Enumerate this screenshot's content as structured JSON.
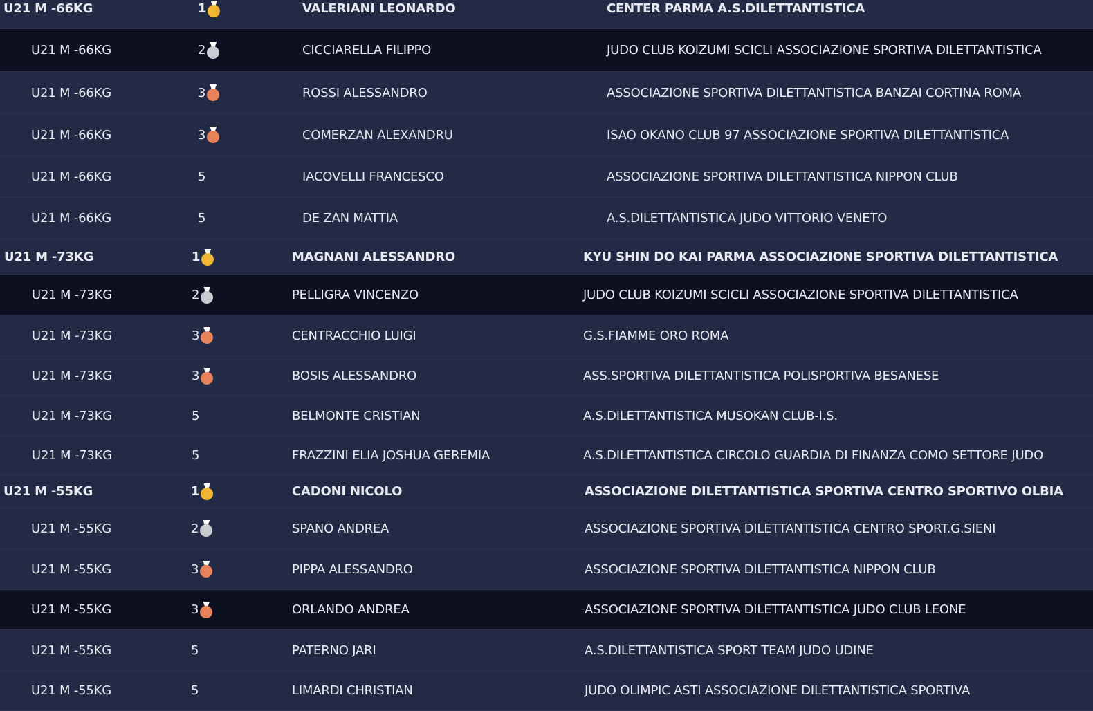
{
  "medal_colors": {
    "gold": "#f2b635",
    "silver": "#c9cbd1",
    "bronze": "#e8825a"
  },
  "groups": [
    {
      "category": "U21 M -66KG",
      "rows": [
        {
          "category": "U21 M -66KG",
          "place": "1",
          "medal": "gold",
          "name": "VALERIANI LEONARDO",
          "club": "CENTER PARMA A.S.DILETTANTISTICA",
          "head": true,
          "dark": false
        },
        {
          "category": "U21 M -66KG",
          "place": "2",
          "medal": "silver",
          "name": "CICCIARELLA FILIPPO",
          "club": "JUDO CLUB KOIZUMI SCICLI ASSOCIAZIONE SPORTIVA DILETTANTISTICA",
          "head": false,
          "dark": true
        },
        {
          "category": "U21 M -66KG",
          "place": "3",
          "medal": "bronze",
          "name": "ROSSI ALESSANDRO",
          "club": "ASSOCIAZIONE SPORTIVA DILETTANTISTICA BANZAI CORTINA ROMA",
          "head": false,
          "dark": false
        },
        {
          "category": "U21 M -66KG",
          "place": "3",
          "medal": "bronze",
          "name": "COMERZAN ALEXANDRU",
          "club": "ISAO OKANO CLUB 97 ASSOCIAZIONE SPORTIVA DILETTANTISTICA",
          "head": false,
          "dark": false
        },
        {
          "category": "U21 M -66KG",
          "place": "5",
          "medal": "",
          "name": "IACOVELLI FRANCESCO",
          "club": "ASSOCIAZIONE SPORTIVA DILETTANTISTICA NIPPON CLUB",
          "head": false,
          "dark": false
        },
        {
          "category": "U21 M -66KG",
          "place": "5",
          "medal": "",
          "name": "DE ZAN MATTIA",
          "club": "A.S.DILETTANTISTICA JUDO VITTORIO VENETO",
          "head": false,
          "dark": false
        }
      ]
    },
    {
      "category": "U21 M -73KG",
      "rows": [
        {
          "category": "U21 M -73KG",
          "place": "1",
          "medal": "gold",
          "name": "MAGNANI ALESSANDRO",
          "club": "KYU SHIN DO KAI PARMA ASSOCIAZIONE SPORTIVA DILETTANTISTICA",
          "head": true,
          "dark": false
        },
        {
          "category": "U21 M -73KG",
          "place": "2",
          "medal": "silver",
          "name": "PELLIGRA VINCENZO",
          "club": "JUDO CLUB KOIZUMI SCICLI ASSOCIAZIONE SPORTIVA DILETTANTISTICA",
          "head": false,
          "dark": true
        },
        {
          "category": "U21 M -73KG",
          "place": "3",
          "medal": "bronze",
          "name": "CENTRACCHIO LUIGI",
          "club": "G.S.FIAMME ORO ROMA",
          "head": false,
          "dark": false
        },
        {
          "category": "U21 M -73KG",
          "place": "3",
          "medal": "bronze",
          "name": "BOSIS ALESSANDRO",
          "club": "ASS.SPORTIVA DILETTANTISTICA POLISPORTIVA BESANESE",
          "head": false,
          "dark": false
        },
        {
          "category": "U21 M -73KG",
          "place": "5",
          "medal": "",
          "name": "BELMONTE CRISTIAN",
          "club": "A.S.DILETTANTISTICA MUSOKAN CLUB-I.S.",
          "head": false,
          "dark": false
        },
        {
          "category": "U21 M -73KG",
          "place": "5",
          "medal": "",
          "name": "FRAZZINI ELIA JOSHUA GEREMIA",
          "club": "A.S.DILETTANTISTICA CIRCOLO GUARDIA DI FINANZA COMO SETTORE JUDO",
          "head": false,
          "dark": false
        }
      ]
    },
    {
      "category": "U21 M -55KG",
      "rows": [
        {
          "category": "U21 M -55KG",
          "place": "1",
          "medal": "gold",
          "name": "CADONI NICOLO",
          "club": "ASSOCIAZIONE DILETTANTISTICA SPORTIVA CENTRO SPORTIVO OLBIA",
          "head": true,
          "dark": false
        },
        {
          "category": "U21 M -55KG",
          "place": "2",
          "medal": "silver",
          "name": "SPANO ANDREA",
          "club": "ASSOCIAZIONE SPORTIVA DILETTANTISTICA CENTRO SPORT.G.SIENI",
          "head": false,
          "dark": false
        },
        {
          "category": "U21 M -55KG",
          "place": "3",
          "medal": "bronze",
          "name": "PIPPA ALESSANDRO",
          "club": "ASSOCIAZIONE SPORTIVA DILETTANTISTICA NIPPON CLUB",
          "head": false,
          "dark": false
        },
        {
          "category": "U21 M -55KG",
          "place": "3",
          "medal": "bronze",
          "name": "ORLANDO ANDREA",
          "club": "ASSOCIAZIONE SPORTIVA DILETTANTISTICA JUDO CLUB LEONE",
          "head": false,
          "dark": true
        },
        {
          "category": "U21 M -55KG",
          "place": "5",
          "medal": "",
          "name": "PATERNO JARI",
          "club": "A.S.DILETTANTISTICA SPORT TEAM JUDO UDINE",
          "head": false,
          "dark": false
        },
        {
          "category": "U21 M -55KG",
          "place": "5",
          "medal": "",
          "name": "LIMARDI CHRISTIAN",
          "club": "JUDO OLIMPIC ASTI ASSOCIAZIONE DILETTANTISTICA SPORTIVA",
          "head": false,
          "dark": false
        }
      ]
    }
  ]
}
